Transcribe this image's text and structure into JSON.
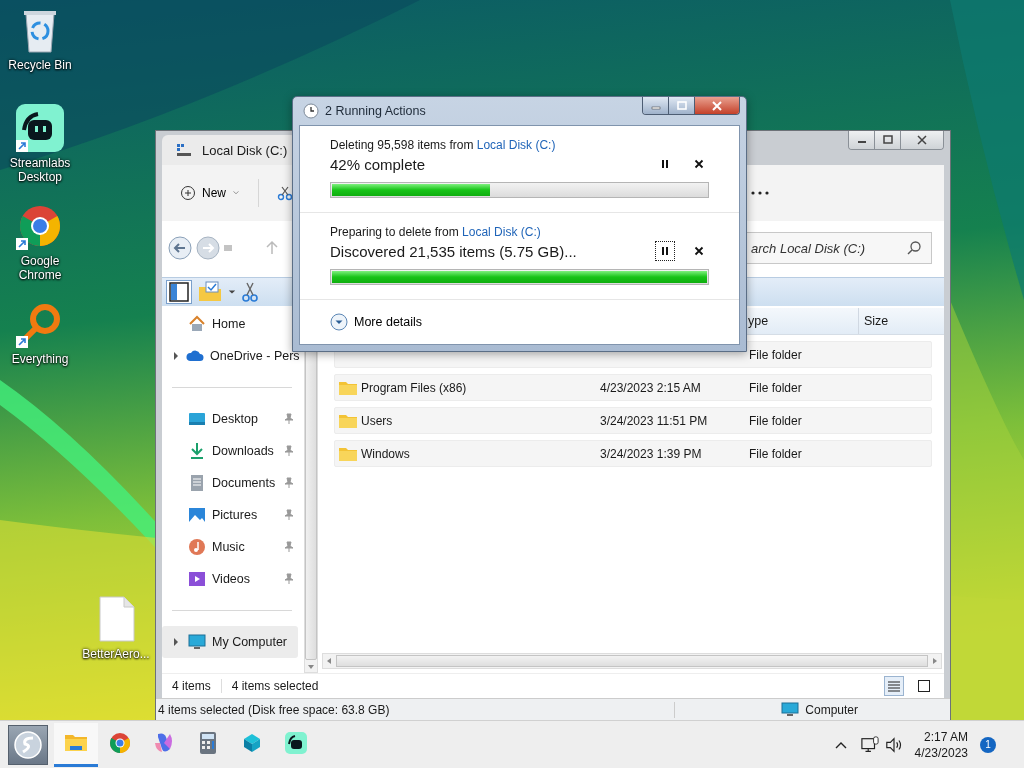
{
  "desktop_icons": [
    {
      "label": "Recycle Bin",
      "kind": "bin",
      "shortcut": false
    },
    {
      "label": "Streamlabs Desktop",
      "kind": "streamlabs",
      "shortcut": true
    },
    {
      "label": "Google Chrome",
      "kind": "chrome",
      "shortcut": true
    },
    {
      "label": "Everything",
      "kind": "everything",
      "shortcut": true
    },
    {
      "label": "BetterAero...",
      "kind": "file",
      "shortcut": false
    }
  ],
  "explorer": {
    "tab_title": "Local Disk (C:)",
    "new_label": "New",
    "search_placeholder": "arch Local Disk (C:)",
    "sidebar": [
      [
        {
          "label": "Home",
          "kind": "home",
          "expandable": false,
          "pinned": false,
          "selected": false
        },
        {
          "label": "OneDrive - Pers",
          "kind": "cloud",
          "expandable": true,
          "pinned": false,
          "selected": false
        }
      ],
      [
        {
          "label": "Desktop",
          "kind": "desktop",
          "expandable": false,
          "pinned": true,
          "selected": false
        },
        {
          "label": "Downloads",
          "kind": "download",
          "expandable": false,
          "pinned": true,
          "selected": false
        },
        {
          "label": "Documents",
          "kind": "documents",
          "expandable": false,
          "pinned": true,
          "selected": false
        },
        {
          "label": "Pictures",
          "kind": "pictures",
          "expandable": false,
          "pinned": true,
          "selected": false
        },
        {
          "label": "Music",
          "kind": "music",
          "expandable": false,
          "pinned": true,
          "selected": false
        },
        {
          "label": "Videos",
          "kind": "videos",
          "expandable": false,
          "pinned": true,
          "selected": false
        }
      ],
      [
        {
          "label": "My Computer",
          "kind": "computer",
          "expandable": true,
          "pinned": false,
          "selected": true
        }
      ]
    ],
    "columns": [
      {
        "label": "ype"
      },
      {
        "label": "Size"
      }
    ],
    "rows": [
      {
        "type": "File folder"
      },
      {
        "name": "Program Files (x86)",
        "date": "4/23/2023 2:15 AM",
        "type": "File folder"
      },
      {
        "name": "Users",
        "date": "3/24/2023 11:51 PM",
        "type": "File folder"
      },
      {
        "name": "Windows",
        "date": "3/24/2023 1:39 PM",
        "type": "File folder"
      }
    ],
    "item_count": "4 items",
    "selection_count": "4 items selected",
    "views": [
      {
        "kind": "details",
        "selected": true
      },
      {
        "kind": "tiles",
        "selected": false
      }
    ],
    "status_text": "4 items selected (Disk free space: 63.8 GB)",
    "status_location": "Computer"
  },
  "dialog": {
    "title": "2 Running Actions",
    "operations": [
      {
        "caption": "Deleting 95,598 items from",
        "location": "Local Disk (C:)",
        "status": "42% complete",
        "level": 0.42,
        "pause_focused": false
      },
      {
        "caption": "Preparing to delete from",
        "location": "Local Disk (C:)",
        "status": "Discovered 21,535 items (5.75 GB)...",
        "level": 1,
        "pause_focused": true
      }
    ],
    "more_details": "More details"
  },
  "taskbar": {
    "apps": [
      {
        "kind": "explorer",
        "running": true
      },
      {
        "kind": "chrome",
        "running": false
      },
      {
        "kind": "copilot",
        "running": false
      },
      {
        "kind": "calculator",
        "running": false
      },
      {
        "kind": "blocks",
        "running": false
      },
      {
        "kind": "streamlabs",
        "running": false
      }
    ],
    "time": "2:17 AM",
    "date": "4/23/2023",
    "notification_count": "1"
  }
}
